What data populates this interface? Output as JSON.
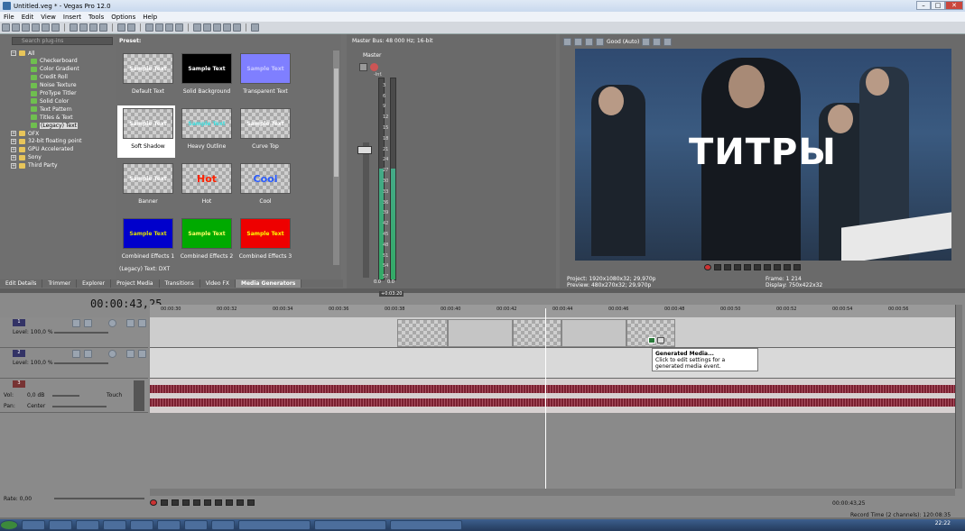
{
  "window": {
    "title": "Untitled.veg * - Vegas Pro 12.0",
    "min": "–",
    "max": "□",
    "close": "✕"
  },
  "menu": [
    "File",
    "Edit",
    "View",
    "Insert",
    "Tools",
    "Options",
    "Help"
  ],
  "explorer": {
    "search_placeholder": "Search plug-ins",
    "items": [
      {
        "label": "All",
        "level": 0,
        "type": "folder",
        "expanded": true
      },
      {
        "label": "Checkerboard",
        "level": 1,
        "type": "gen"
      },
      {
        "label": "Color Gradient",
        "level": 1,
        "type": "gen"
      },
      {
        "label": "Credit Roll",
        "level": 1,
        "type": "gen"
      },
      {
        "label": "Noise Texture",
        "level": 1,
        "type": "gen"
      },
      {
        "label": "ProType Titler",
        "level": 1,
        "type": "gen"
      },
      {
        "label": "Solid Color",
        "level": 1,
        "type": "gen"
      },
      {
        "label": "Text Pattern",
        "level": 1,
        "type": "gen"
      },
      {
        "label": "Titles & Text",
        "level": 1,
        "type": "gen"
      },
      {
        "label": "(Legacy) Text",
        "level": 1,
        "type": "gen",
        "selected": true
      },
      {
        "label": "OFX",
        "level": 0,
        "type": "folder"
      },
      {
        "label": "32-bit floating point",
        "level": 0,
        "type": "folder"
      },
      {
        "label": "GPU Accelerated",
        "level": 0,
        "type": "folder"
      },
      {
        "label": "Sony",
        "level": 0,
        "type": "folder"
      },
      {
        "label": "Third Party",
        "level": 0,
        "type": "folder"
      }
    ]
  },
  "preset": {
    "header": "Preset:",
    "items": [
      {
        "label": "Default Text",
        "thumb": "Sample Text",
        "style": "checker",
        "color": "#ffffff"
      },
      {
        "label": "Solid Background",
        "thumb": "Sample Text",
        "style": "solid",
        "bg": "#000000",
        "color": "#ffffff"
      },
      {
        "label": "Transparent Text",
        "thumb": "Sample Text",
        "style": "solid",
        "bg": "#7f7fff",
        "color": "#c8c8ff"
      },
      {
        "label": "Soft Shadow",
        "thumb": "Sample Text",
        "style": "checker",
        "color": "#ffffff",
        "selected": true
      },
      {
        "label": "Heavy Outline",
        "thumb": "Sample Text",
        "style": "checker",
        "color": "#3fe0e0"
      },
      {
        "label": "Curve Top",
        "thumb": "Sample Text",
        "style": "checker",
        "color": "#ffffff"
      },
      {
        "label": "Banner",
        "thumb": "Sample Text",
        "style": "checker",
        "color": "#ffffff"
      },
      {
        "label": "Hot",
        "thumb": "Hot",
        "style": "checker",
        "color": "#ff2200",
        "big": true
      },
      {
        "label": "Cool",
        "thumb": "Cool",
        "style": "checker",
        "color": "#2a5cff",
        "big": true
      },
      {
        "label": "Combined Effects 1",
        "thumb": "Sample Text",
        "style": "solid",
        "bg": "#0000cc",
        "color": "#e0e000"
      },
      {
        "label": "Combined Effects 2",
        "thumb": "Sample Text",
        "style": "solid",
        "bg": "#00aa00",
        "color": "#ffff66"
      },
      {
        "label": "Combined Effects 3",
        "thumb": "Sample Text",
        "style": "solid",
        "bg": "#ee0000",
        "color": "#ffff00"
      }
    ],
    "status": "(Legacy) Text: DXT"
  },
  "tabs": [
    "Edit Details",
    "Trimmer",
    "Explorer",
    "Project Media",
    "Transitions",
    "Video FX",
    "Media Generators"
  ],
  "master": {
    "header": "Master Bus: 48 000 Hz; 16-bit",
    "label": "Master",
    "scale": [
      "-Inf.",
      "3",
      "6",
      "9",
      "12",
      "15",
      "18",
      "21",
      "24",
      "27",
      "30",
      "33",
      "36",
      "39",
      "42",
      "45",
      "48",
      "51",
      "54",
      "57"
    ],
    "bottom": [
      "0.0",
      "0.0"
    ]
  },
  "preview": {
    "quality": "Good (Auto)",
    "title_text": "ТИТРЫ",
    "project": "Project:  1920x1080x32; 29,970p",
    "preview": "Preview:  480x270x32; 29,970p",
    "frame": "Frame:     1 214",
    "display": "Display:   750x422x32"
  },
  "timeline": {
    "time": "00:00:43,25",
    "marker": "+0:03:20",
    "ruler": [
      "00:00:30",
      "00:00:32",
      "00:00:34",
      "00:00:36",
      "00:00:38",
      "00:00:40",
      "00:00:42",
      "00:00:44",
      "00:00:46",
      "00:00:48",
      "00:00:50",
      "00:00:52",
      "00:00:54",
      "00:00:56"
    ],
    "tracks": [
      {
        "num": "1",
        "level": "Level: 100,0 %"
      },
      {
        "num": "2",
        "level": "Level: 100,0 %"
      },
      {
        "num": "3",
        "vol": "Vol:",
        "vol_val": "0,0 dB",
        "touch": "Touch",
        "pan": "Pan:",
        "pan_val": "Center"
      }
    ],
    "rate": "Rate: 0,00",
    "end_time": "00:00:43,25",
    "record_time": "Record Time (2 channels): 120:08:35"
  },
  "tooltip": {
    "title": "Generated Media...",
    "body": "Click to edit settings for a generated media event."
  },
  "taskbar": {
    "clock": "22:22"
  }
}
